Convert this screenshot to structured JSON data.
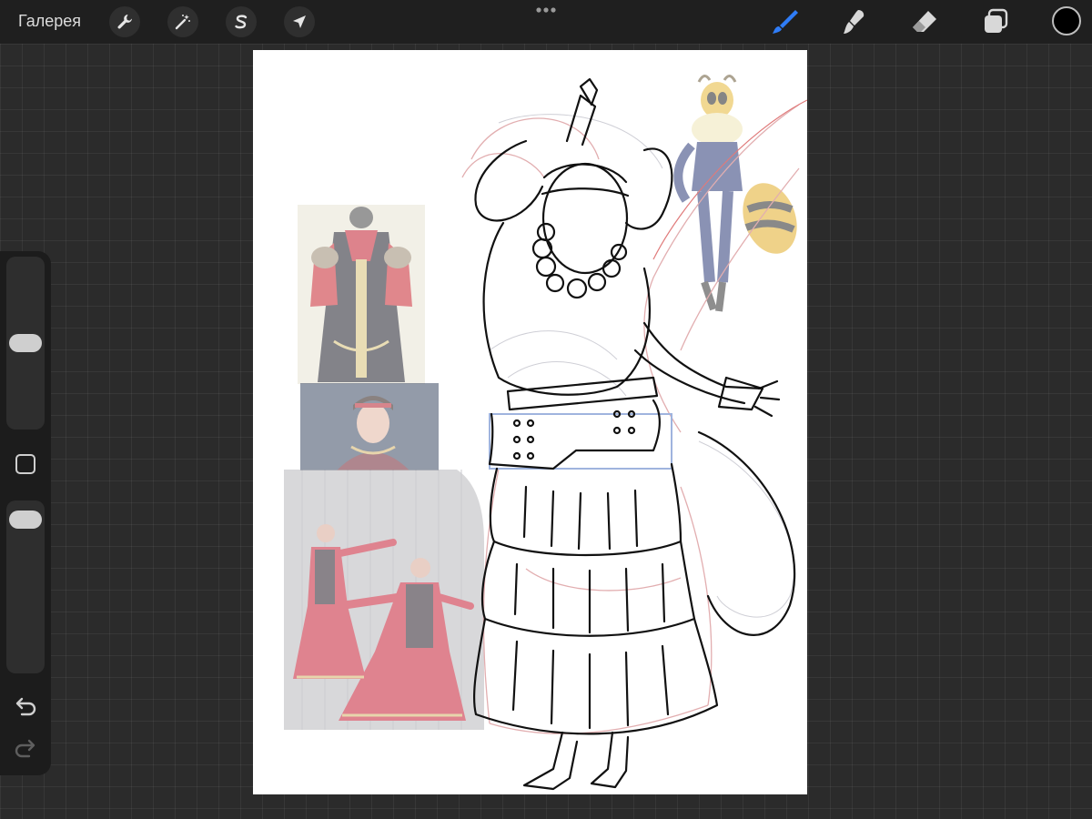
{
  "toolbar": {
    "gallery_label": "Галерея",
    "left_tools": [
      "wrench-icon",
      "magic-wand-icon",
      "selection-s-icon",
      "transform-arrow-icon"
    ],
    "right_tools": [
      "brush-icon",
      "smudge-icon",
      "eraser-icon",
      "layers-icon"
    ],
    "active_tool": "brush",
    "accent_color": "#2f7cf6",
    "current_color": "#000000"
  },
  "sidebar": {
    "brush_size_level": 0.5,
    "opacity_level": 0.97
  },
  "canvas": {
    "background": "#ffffff",
    "reference_images": [
      "costume-dress-reference",
      "portrait-reference",
      "dancers-reference",
      "bee-character-reference"
    ]
  }
}
